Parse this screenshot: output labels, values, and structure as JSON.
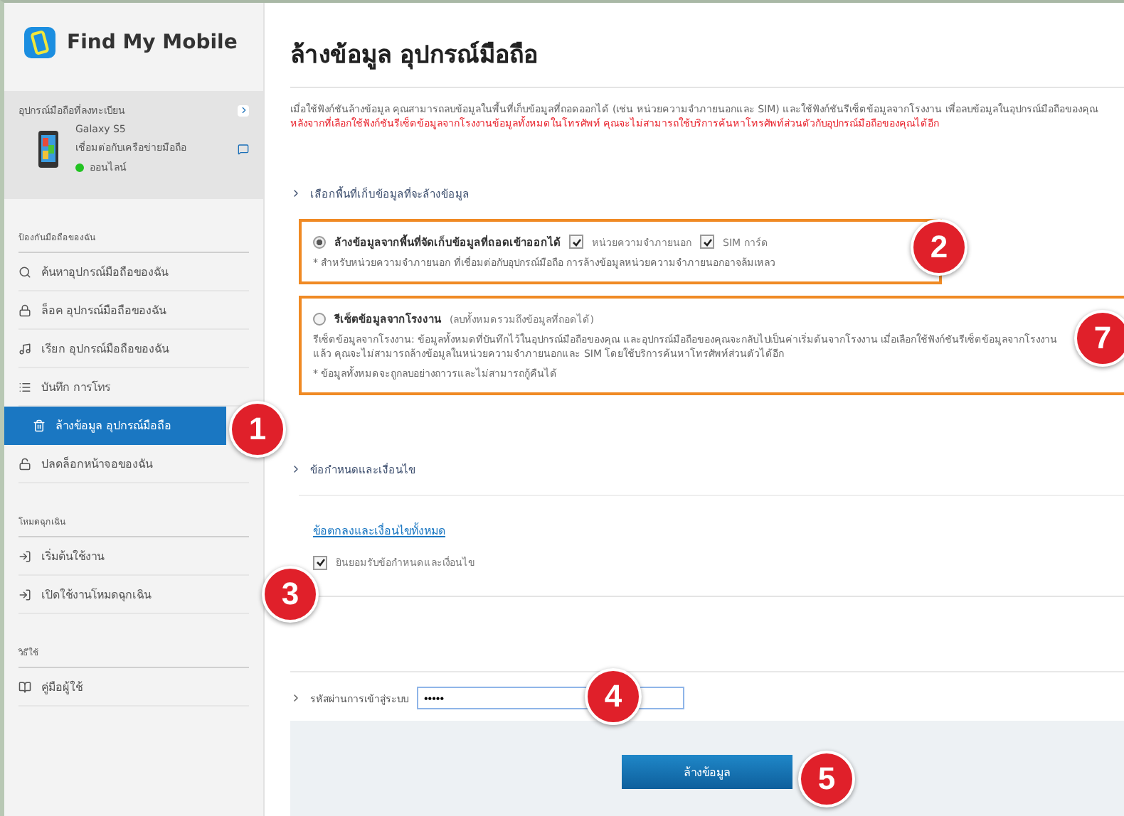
{
  "app": {
    "name": "Find My Mobile"
  },
  "device_panel": {
    "heading": "อุปกรณ์มือถือที่ลงทะเบียน",
    "model": "Galaxy S5",
    "network": "เชื่อมต่อกับเครือข่ายมือถือ",
    "status": "ออนไลน์",
    "online": true
  },
  "sidebar": {
    "sections": [
      {
        "heading": "ป้องกันมือถือของฉัน",
        "items": [
          {
            "kind": "search",
            "label": "ค้นหาอุปกรณ์มือถือของฉัน",
            "selected": false
          },
          {
            "kind": "lock",
            "label": "ล็อค อุปกรณ์มือถือของฉัน",
            "selected": false
          },
          {
            "kind": "ring",
            "label": "เรียก อุปกรณ์มือถือของฉัน",
            "selected": false
          },
          {
            "kind": "log",
            "label": "บันทึก การโทร",
            "selected": false
          },
          {
            "kind": "wipe",
            "label": "ล้างข้อมูล อุปกรณ์มือถือ",
            "selected": true
          },
          {
            "kind": "unlock",
            "label": "ปลดล็อกหน้าจอของฉัน",
            "selected": false
          }
        ]
      },
      {
        "heading": "โหมดฉุกเฉิน",
        "items": [
          {
            "kind": "exit",
            "label": "เริ่มต้นใช้งาน",
            "selected": false
          },
          {
            "kind": "exit",
            "label": "เปิดใช้งานโหมดฉุกเฉิน",
            "selected": false
          }
        ]
      },
      {
        "heading": "วิธีใช้",
        "items": [
          {
            "kind": "guide",
            "label": "คู่มือผู้ใช้",
            "selected": false
          }
        ]
      }
    ]
  },
  "page": {
    "title": "ล้างข้อมูล อุปกรณ์มือถือ",
    "intro": "เมื่อใช้ฟังก์ชันล้างข้อมูล คุณสามารถลบข้อมูลในพื้นที่เก็บข้อมูลที่ถอดออกได้ (เช่น หน่วยความจำภายนอกและ SIM) และใช้ฟังก์ชันรีเซ็ตข้อมูลจากโรงงาน เพื่อลบข้อมูลในอุปกรณ์มือถือของคุณ",
    "warning": "หลังจากที่เลือกใช้ฟังก์ชันรีเซ็ตข้อมูลจากโรงงานข้อมูลทั้งหมดในโทรศัพท์ คุณจะไม่สามารถใช้บริการค้นหาโทรศัพท์ส่วนตัวกับอุปกรณ์มือถือของคุณได้อีก",
    "storage_heading": "เลือกพื้นที่เก็บข้อมูลที่จะล้างข้อมูล",
    "options": [
      {
        "label": "ล้างข้อมูลจากพื้นที่จัดเก็บข้อมูลที่ถอดเข้าออกได้",
        "selected": true,
        "checks": [
          {
            "label": "หน่วยความจำภายนอก",
            "checked": true
          },
          {
            "label": "SIM การ์ด",
            "checked": true
          }
        ],
        "notes": [
          "* สำหรับหน่วยความจำภายนอก ที่เชื่อมต่อกับอุปกรณ์มือถือ การล้างข้อมูลหน่วยความจำภายนอกอาจล้มเหลว"
        ]
      },
      {
        "label": "รีเซ็ตข้อมูลจากโรงงาน",
        "suffix": "(ลบทั้งหมดรวมถึงข้อมูลที่ถอดได้)",
        "selected": false,
        "notes": [
          "รีเซ็ตข้อมูลจากโรงงาน: ข้อมูลทั้งหมดที่บันทึกไว้ในอุปกรณ์มือถือของคุณ และอุปกรณ์มือถือของคุณจะกลับไปเป็นค่าเริ่มต้นจากโรงงาน เมื่อเลือกใช้ฟังก์ชันรีเซ็ตข้อมูลจากโรงงานแล้ว คุณจะไม่สามารถล้างข้อมูลในหน่วยความจำภายนอกและ SIM โดยใช้บริการค้นหาโทรศัพท์ส่วนตัวได้อีก",
          "* ข้อมูลทั้งหมดจะถูกลบอย่างถาวรและไม่สามารถกู้คืนได้"
        ]
      }
    ],
    "terms_heading": "ข้อกำหนดและเงื่อนไข",
    "terms_link": "ข้อตกลงและเงื่อนไขทั้งหมด",
    "terms_check": {
      "label": "ยินยอมรับข้อกำหนดและเงื่อนไข",
      "checked": true
    },
    "password_label": "รหัสผ่านการเข้าสู่ระบบ",
    "password_value": "•••••",
    "button": "ล้างข้อมูล"
  },
  "callouts": [
    {
      "label": "1"
    },
    {
      "label": "2"
    },
    {
      "label": "7"
    },
    {
      "label": "3"
    },
    {
      "label": "4"
    },
    {
      "label": "5"
    }
  ]
}
